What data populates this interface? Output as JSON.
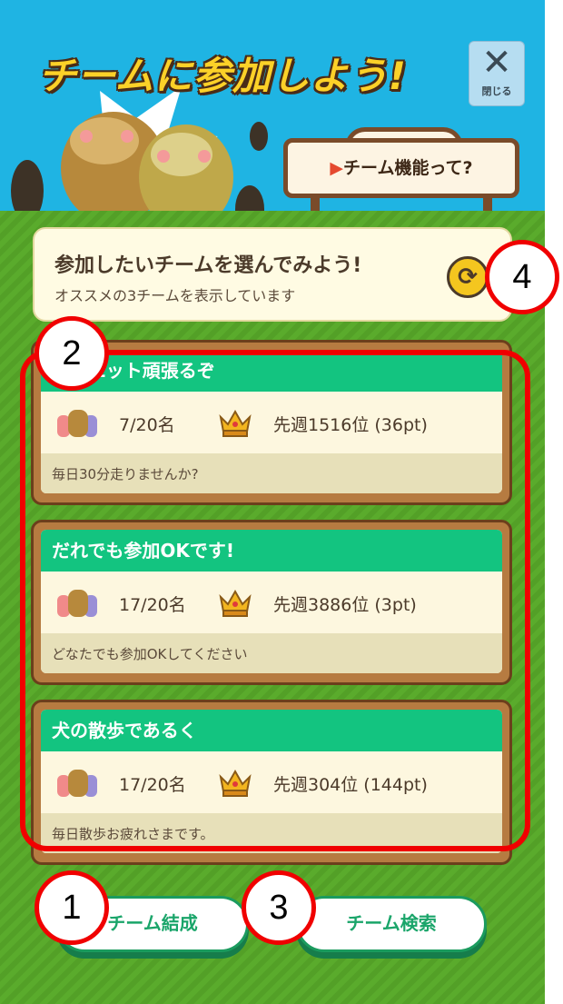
{
  "header": {
    "title": "チームに参加しよう!",
    "close_label": "閉じる",
    "close_icon": "✕",
    "sign_arrow": "▶",
    "sign_label": "チーム機能って?"
  },
  "guide": {
    "title": "参加したいチームを選んでみよう!",
    "subtitle": "オススメの3チームを表示しています",
    "refresh_icon": "⟳"
  },
  "teams": [
    {
      "name": "ダイエット頑張るぞ",
      "members": "7/20名",
      "rank": "先週1516位 (36pt)",
      "description": "毎日30分走りませんか?"
    },
    {
      "name": "だれでも参加OKです!",
      "members": "17/20名",
      "rank": "先週3886位 (3pt)",
      "description": "どなたでも参加OKしてください"
    },
    {
      "name": "犬の散歩であるく",
      "members": "17/20名",
      "rank": "先週304位 (144pt)",
      "description": "毎日散歩お疲れさまです。"
    }
  ],
  "buttons": {
    "create": "チーム結成",
    "search": "チーム検索"
  },
  "annotations": {
    "n1": "1",
    "n2": "2",
    "n3": "3",
    "n4": "4"
  },
  "colors": {
    "sky": "#1fb4e3",
    "grass": "#58a62a",
    "team_header": "#13c480",
    "button_text": "#1aa56a",
    "annotation": "#f00000"
  }
}
